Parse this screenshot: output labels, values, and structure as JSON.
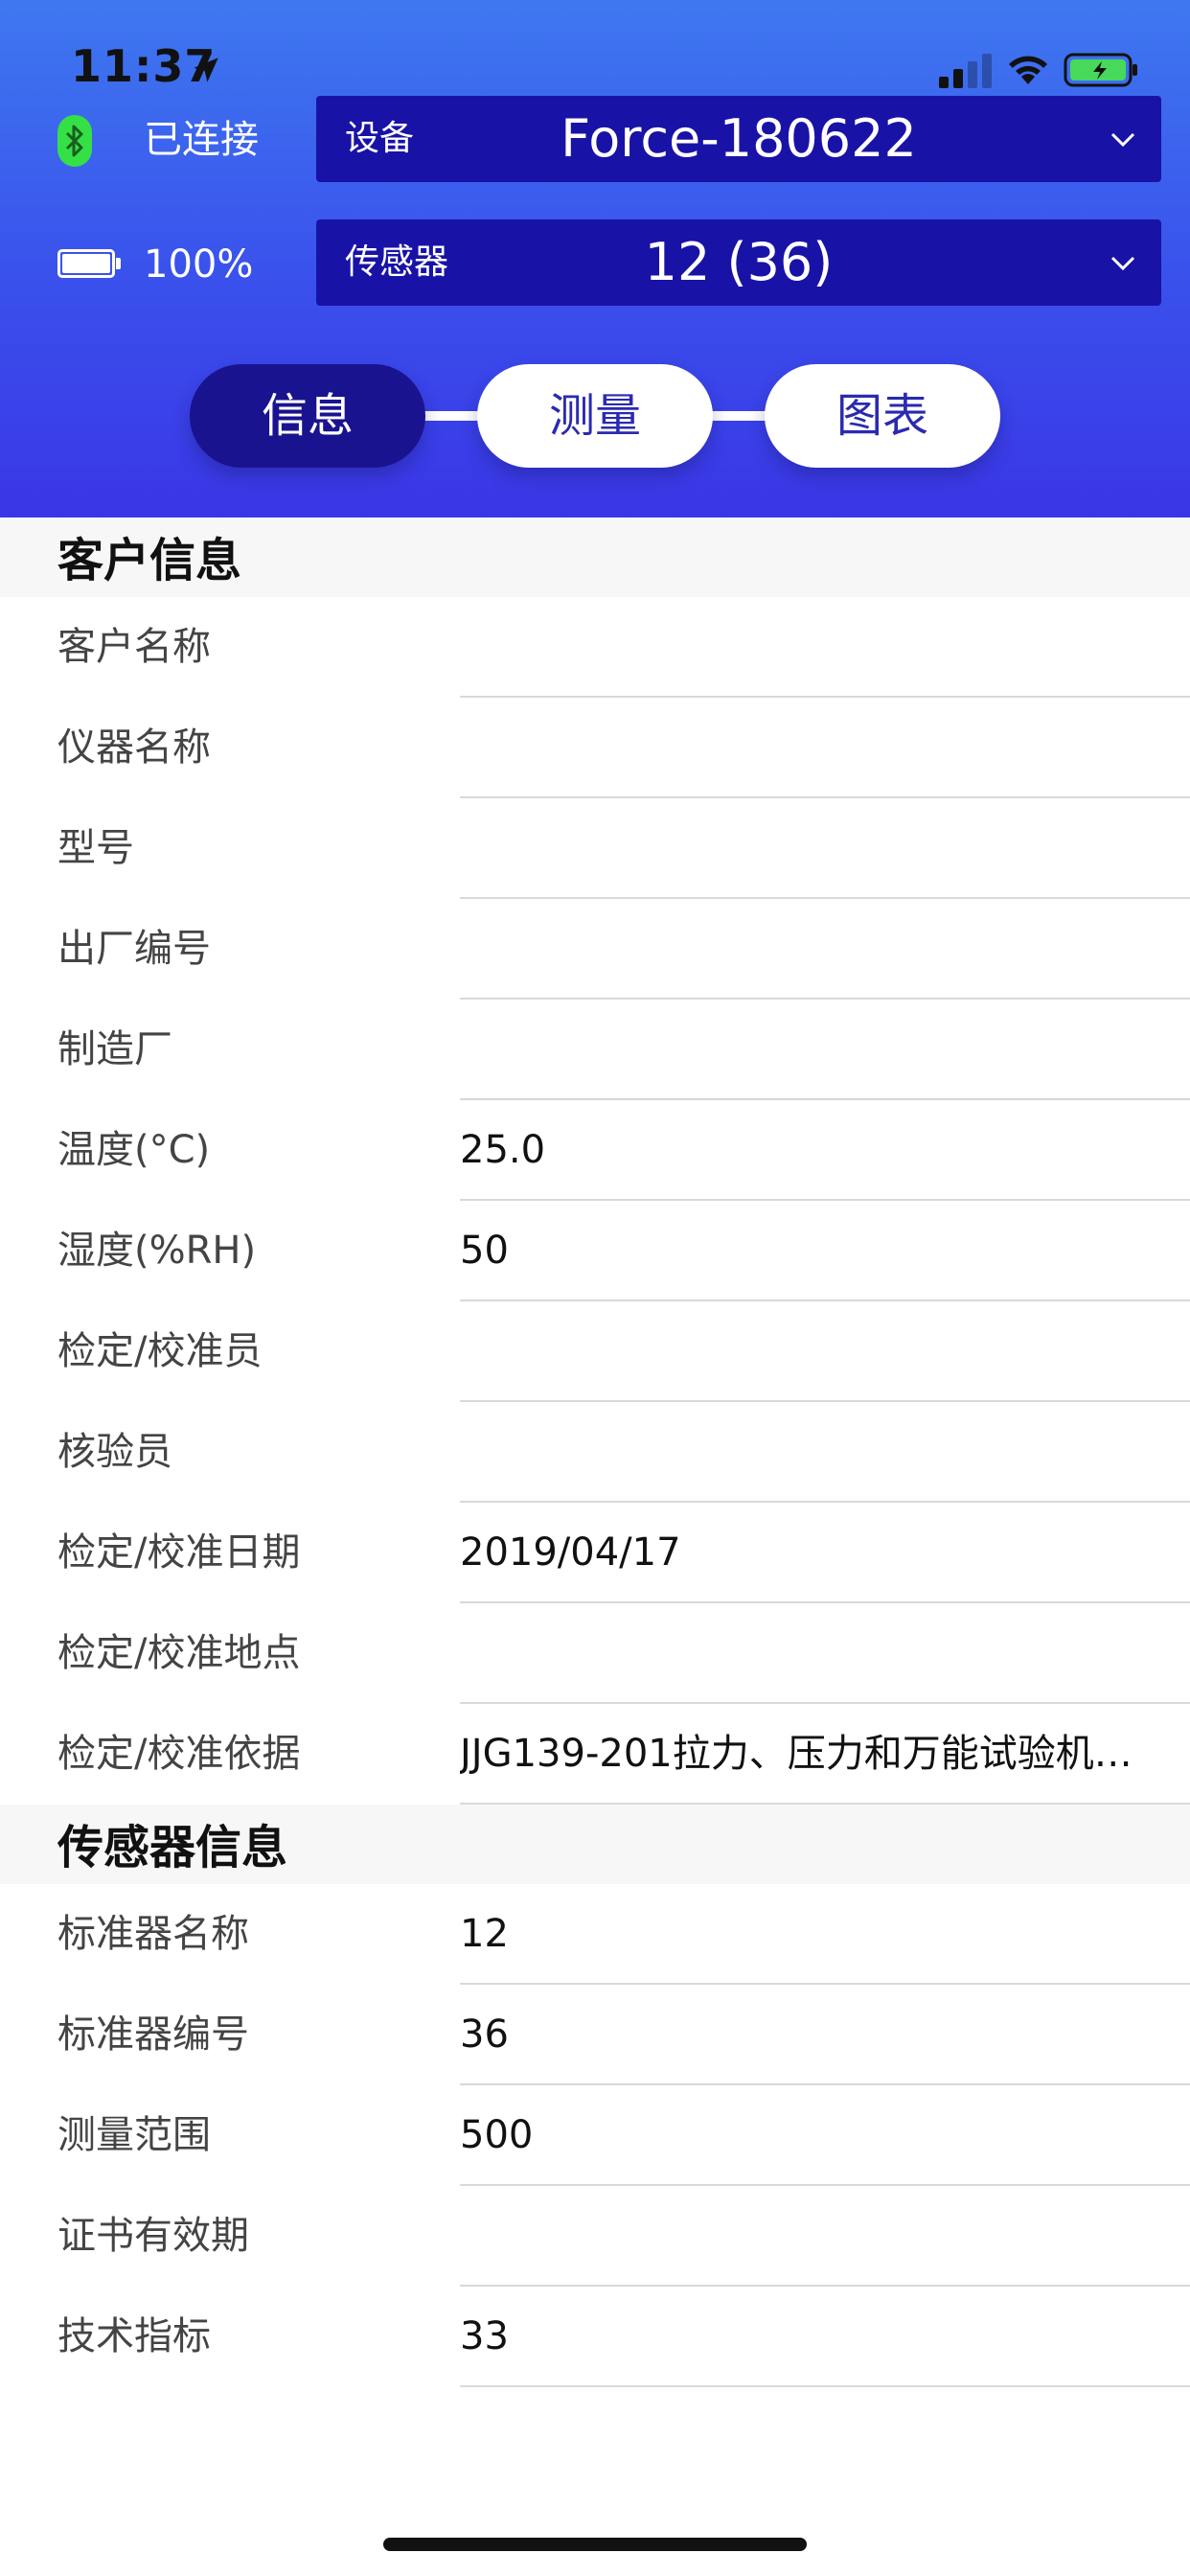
{
  "status_bar": {
    "time": "11:37"
  },
  "device": {
    "connection_status": "已连接",
    "battery_text": "100%",
    "battery_level": 1.0
  },
  "selectors": {
    "device": {
      "label": "设备",
      "value": "Force-180622"
    },
    "sensor": {
      "label": "传感器",
      "value": "12 (36)"
    }
  },
  "tabs": [
    {
      "label": "信息",
      "active": true
    },
    {
      "label": "测量",
      "active": false
    },
    {
      "label": "图表",
      "active": false
    }
  ],
  "customer_section": {
    "title": "客户信息",
    "rows": [
      {
        "label": "客户名称",
        "value": ""
      },
      {
        "label": "仪器名称",
        "value": ""
      },
      {
        "label": "型号",
        "value": ""
      },
      {
        "label": "出厂编号",
        "value": ""
      },
      {
        "label": "制造厂",
        "value": ""
      },
      {
        "label": "温度(°C)",
        "value": "25.0"
      },
      {
        "label": "湿度(%RH)",
        "value": "50"
      },
      {
        "label": "检定/校准员",
        "value": ""
      },
      {
        "label": "核验员",
        "value": ""
      },
      {
        "label": "检定/校准日期",
        "value": "2019/04/17"
      },
      {
        "label": "检定/校准地点",
        "value": ""
      },
      {
        "label": "检定/校准依据",
        "value": "JJG139-201拉力、压力和万能试验机…"
      }
    ]
  },
  "sensor_section": {
    "title": "传感器信息",
    "rows": [
      {
        "label": "标准器名称",
        "value": "12"
      },
      {
        "label": "标准器编号",
        "value": "36"
      },
      {
        "label": "测量范围",
        "value": "500"
      },
      {
        "label": "证书有效期",
        "value": ""
      },
      {
        "label": "技术指标",
        "value": "33"
      }
    ]
  },
  "colors": {
    "header_top": "#3e78f0",
    "header_bottom": "#3a36e6",
    "selector_bg": "#1912a6",
    "active_tab": "#1a138f",
    "bluetooth": "#34e046"
  },
  "icons": [
    "location-arrow-icon",
    "cellular-signal-icon",
    "wifi-icon",
    "phone-battery-icon",
    "bluetooth-icon",
    "device-battery-icon",
    "chevron-down-icon"
  ]
}
